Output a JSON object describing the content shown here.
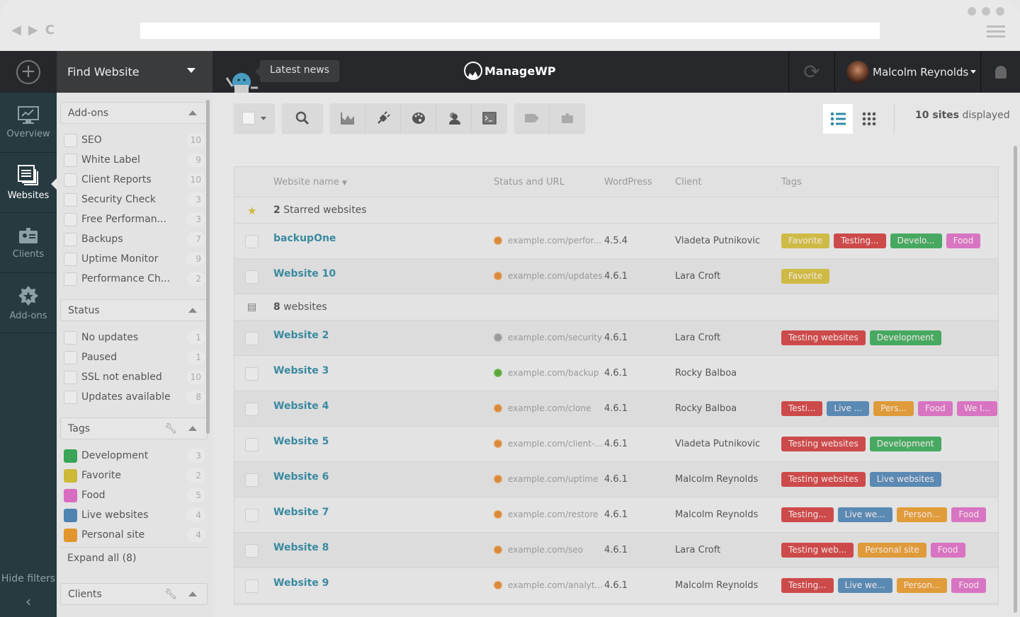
{
  "browser": {
    "back_icon": "◀",
    "forward_icon": "▶",
    "reload_icon": "C"
  },
  "topbar": {
    "find_label": "Find Website",
    "news_label": "Latest news",
    "brand": "ManageWP",
    "user_name": "Malcolm Reynolds"
  },
  "leftnav": {
    "items": [
      {
        "label": "Overview",
        "icon": "monitor-chart-icon"
      },
      {
        "label": "Websites",
        "icon": "websites-list-icon",
        "active": true
      },
      {
        "label": "Clients",
        "icon": "client-badge-icon"
      },
      {
        "label": "Add-ons",
        "icon": "star-badge-icon"
      }
    ],
    "hide_filters": "Hide filters",
    "hide_arrow": "‹"
  },
  "filters": {
    "addons": {
      "title": "Add-ons",
      "items": [
        {
          "label": "SEO",
          "count": "10"
        },
        {
          "label": "White Label",
          "count": "9"
        },
        {
          "label": "Client Reports",
          "count": "10"
        },
        {
          "label": "Security Check",
          "count": "3"
        },
        {
          "label": "Free Performan...",
          "count": "3"
        },
        {
          "label": "Backups",
          "count": "7"
        },
        {
          "label": "Uptime Monitor",
          "count": "9"
        },
        {
          "label": "Performance Ch...",
          "count": "2"
        }
      ]
    },
    "status": {
      "title": "Status",
      "items": [
        {
          "label": "No updates",
          "count": "1"
        },
        {
          "label": "Paused",
          "count": "1"
        },
        {
          "label": "SSL not enabled",
          "count": "10"
        },
        {
          "label": "Updates available",
          "count": "8"
        }
      ]
    },
    "tags": {
      "title": "Tags",
      "items": [
        {
          "label": "Development",
          "count": "3",
          "color": "#3aa556"
        },
        {
          "label": "Favorite",
          "count": "2",
          "color": "#cdb838"
        },
        {
          "label": "Food",
          "count": "5",
          "color": "#d86cc0"
        },
        {
          "label": "Live websites",
          "count": "4",
          "color": "#4f83b0"
        },
        {
          "label": "Personal site",
          "count": "4",
          "color": "#e0962c"
        }
      ],
      "expand_all": "Expand all (8)"
    },
    "clients": {
      "title": "Clients"
    }
  },
  "main": {
    "sites_count": "10 sites",
    "sites_suffix": " displayed",
    "columns": {
      "name": "Website name",
      "status": "Status and URL",
      "wp": "WordPress",
      "client": "Client",
      "tags": "Tags"
    },
    "groups": [
      {
        "count": "2",
        "label": " Starred websites"
      },
      {
        "count": "8",
        "label": " websites"
      }
    ],
    "starred": [
      {
        "name": "backupOne",
        "status": "orange",
        "url": "example.com/perfor...",
        "wp": "4.5.4",
        "client": "Vladeta Putnikovic",
        "tags": [
          {
            "t": "Favorite",
            "c": "#cdb838"
          },
          {
            "t": "Testing...",
            "c": "#cc3e3e"
          },
          {
            "t": "Develo...",
            "c": "#3aa556"
          },
          {
            "t": "Food",
            "c": "#d86cc0"
          }
        ]
      },
      {
        "name": "Website 10",
        "status": "orange",
        "url": "example.com/updates",
        "wp": "4.6.1",
        "client": "Lara Croft",
        "tags": [
          {
            "t": "Favorite",
            "c": "#cdb838"
          }
        ]
      }
    ],
    "sites": [
      {
        "name": "Website 2",
        "status": "gray",
        "url": "example.com/security",
        "wp": "4.6.1",
        "client": "Lara Croft",
        "tags": [
          {
            "t": "Testing websites",
            "c": "#cc3e3e"
          },
          {
            "t": "Development",
            "c": "#3aa556"
          }
        ]
      },
      {
        "name": "Website 3",
        "status": "green",
        "url": "example.com/backup",
        "wp": "4.6.1",
        "client": "Rocky Balboa",
        "tags": []
      },
      {
        "name": "Website 4",
        "status": "orange",
        "url": "example.com/clone",
        "wp": "4.6.1",
        "client": "Rocky Balboa",
        "tags": [
          {
            "t": "Testi...",
            "c": "#cc3e3e"
          },
          {
            "t": "Live ...",
            "c": "#4f83b0"
          },
          {
            "t": "Pers...",
            "c": "#e0962c"
          },
          {
            "t": "Food",
            "c": "#d86cc0"
          },
          {
            "t": "We I...",
            "c": "#d86cc0"
          }
        ]
      },
      {
        "name": "Website 5",
        "status": "orange",
        "url": "example.com/client-...",
        "wp": "4.6.1",
        "client": "Vladeta Putnikovic",
        "tags": [
          {
            "t": "Testing websites",
            "c": "#cc3e3e"
          },
          {
            "t": "Development",
            "c": "#3aa556"
          }
        ]
      },
      {
        "name": "Website 6",
        "status": "orange",
        "url": "example.com/uptime",
        "wp": "4.6.1",
        "client": "Malcolm Reynolds",
        "tags": [
          {
            "t": "Testing websites",
            "c": "#cc3e3e"
          },
          {
            "t": "Live websites",
            "c": "#4f83b0"
          }
        ]
      },
      {
        "name": "Website 7",
        "status": "orange",
        "url": "example.com/restore",
        "wp": "4.6.1",
        "client": "Malcolm Reynolds",
        "tags": [
          {
            "t": "Testing...",
            "c": "#cc3e3e"
          },
          {
            "t": "Live we...",
            "c": "#4f83b0"
          },
          {
            "t": "Person...",
            "c": "#e0962c"
          },
          {
            "t": "Food",
            "c": "#d86cc0"
          }
        ]
      },
      {
        "name": "Website 8",
        "status": "orange",
        "url": "example.com/seo",
        "wp": "4.6.1",
        "client": "Lara Croft",
        "tags": [
          {
            "t": "Testing web...",
            "c": "#cc3e3e"
          },
          {
            "t": "Personal site",
            "c": "#e0962c"
          },
          {
            "t": "Food",
            "c": "#d86cc0"
          }
        ]
      },
      {
        "name": "Website 9",
        "status": "orange",
        "url": "example.com/analyt...",
        "wp": "4.6.1",
        "client": "Malcolm Reynolds",
        "tags": [
          {
            "t": "Testing...",
            "c": "#cc3e3e"
          },
          {
            "t": "Live we...",
            "c": "#4f83b0"
          },
          {
            "t": "Person...",
            "c": "#e0962c"
          },
          {
            "t": "Food",
            "c": "#d86cc0"
          }
        ]
      }
    ],
    "status_colors": {
      "orange": "#d98a3a",
      "gray": "#9a9a9a",
      "green": "#5aa83a"
    }
  }
}
